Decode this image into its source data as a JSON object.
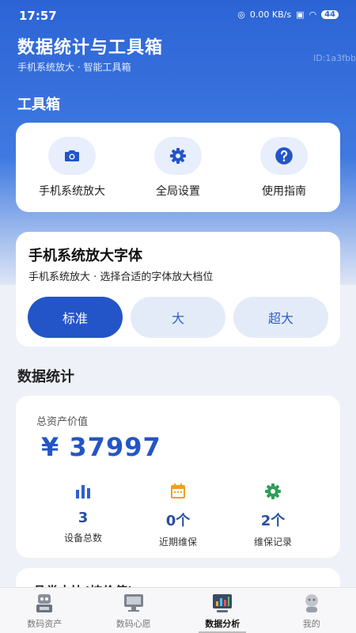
{
  "status": {
    "time": "17:57",
    "speed": "0.00 KB/s",
    "battery": "44"
  },
  "header": {
    "title": "数据统计与工具箱",
    "subtitle": "手机系统放大 · 智能工具箱",
    "id_tag": "ID:1a3fbb"
  },
  "toolbox": {
    "title": "工具箱",
    "items": [
      {
        "label": "手机系统放大",
        "icon": "camera-icon"
      },
      {
        "label": "全局设置",
        "icon": "gear-icon"
      },
      {
        "label": "使用指南",
        "icon": "help-icon"
      }
    ]
  },
  "font_size": {
    "title": "手机系统放大字体",
    "subtitle": "手机系统放大 · 选择合适的字体放大档位",
    "options": [
      "标准",
      "大",
      "超大"
    ],
    "selected": "标准"
  },
  "stats": {
    "title": "数据统计",
    "asset_label": "总资产价值",
    "asset_value": "¥ 37997",
    "items": [
      {
        "value": "3",
        "label": "设备总数",
        "icon": "bar-chart-icon",
        "color": "#2f5fd0"
      },
      {
        "value": "0个",
        "label": "近期维保",
        "icon": "calendar-icon",
        "color": "#f0a020"
      },
      {
        "value": "2个",
        "label": "维保记录",
        "icon": "gear-icon",
        "color": "#2e9e5a"
      }
    ]
  },
  "next_section": {
    "title": "品类占比(按价值)"
  },
  "tabbar": {
    "items": [
      {
        "label": "数码资产",
        "icon": "robot-icon"
      },
      {
        "label": "数码心愿",
        "icon": "monitor-icon"
      },
      {
        "label": "数据分析",
        "icon": "analytics-icon",
        "active": true
      },
      {
        "label": "我的",
        "icon": "profile-icon"
      }
    ]
  },
  "colors": {
    "primary": "#2355c8",
    "hero_top": "#2c64d6",
    "background": "#eef1f8"
  }
}
